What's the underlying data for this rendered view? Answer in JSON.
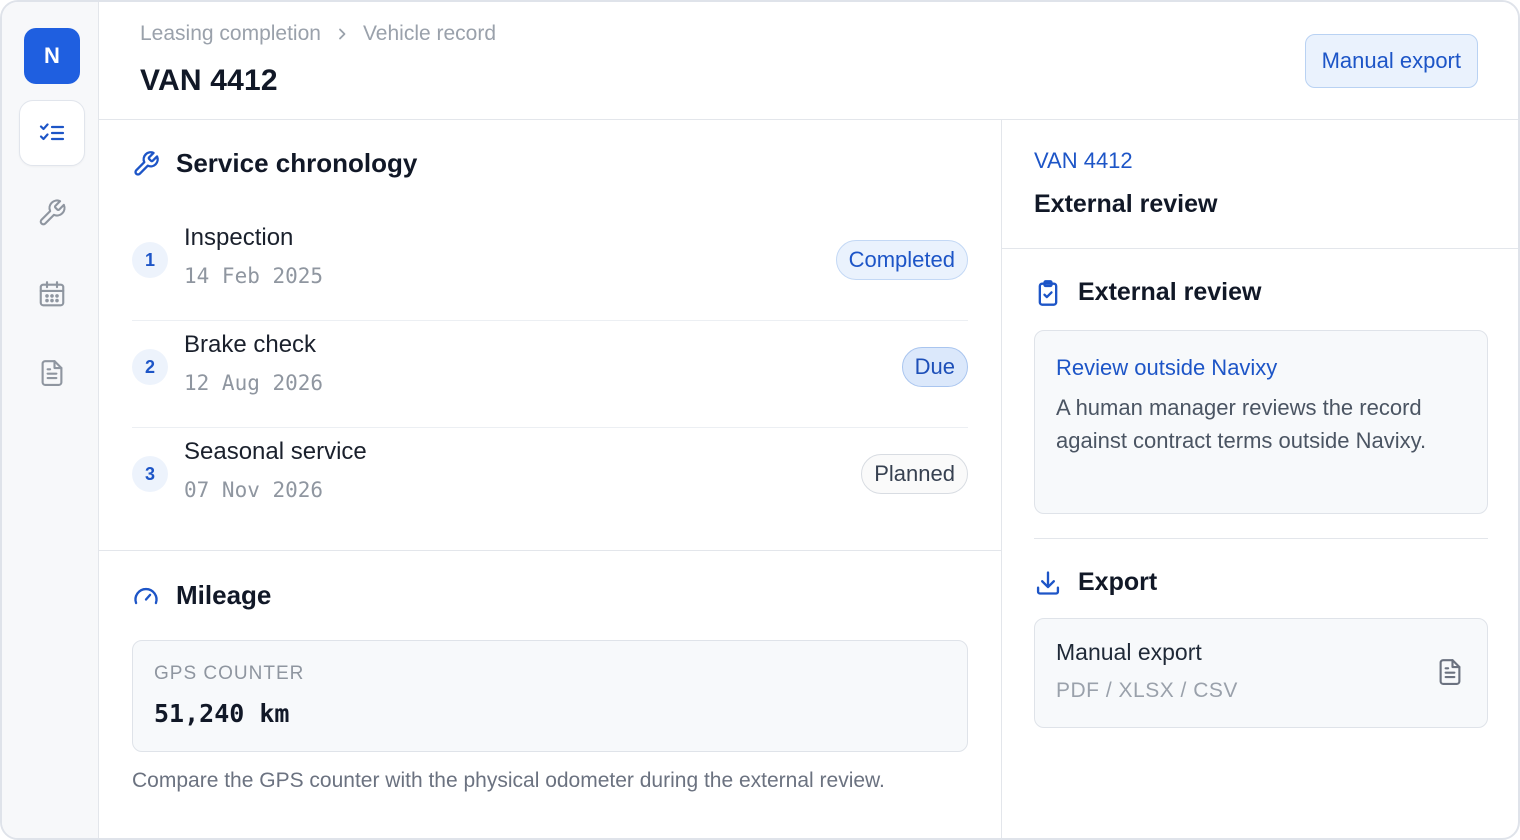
{
  "app": {
    "logo_letter": "N"
  },
  "sidebar": {
    "items": [
      {
        "icon": "checklist-icon",
        "active": true
      },
      {
        "icon": "wrench-icon",
        "active": false
      },
      {
        "icon": "calendar-icon",
        "active": false
      },
      {
        "icon": "document-icon",
        "active": false
      }
    ]
  },
  "breadcrumb": {
    "items": [
      "Leasing completion",
      "Vehicle record"
    ]
  },
  "header": {
    "title": "VAN 4412",
    "action_label": "Manual export"
  },
  "service": {
    "heading": "Service chronology",
    "items": [
      {
        "index": "1",
        "title": "Inspection",
        "date": "14 Feb 2025",
        "status": "Completed"
      },
      {
        "index": "2",
        "title": "Brake check",
        "date": "12 Aug 2026",
        "status": "Due"
      },
      {
        "index": "3",
        "title": "Seasonal service",
        "date": "07 Nov 2026",
        "status": "Planned"
      }
    ]
  },
  "mileage": {
    "heading": "Mileage",
    "counter_label": "GPS COUNTER",
    "counter_value": "51,240 km",
    "note": "Compare the GPS counter with the physical odometer during the external review."
  },
  "right_panel": {
    "vehicle": "VAN 4412",
    "title": "External review",
    "review": {
      "heading": "External review",
      "link": "Review outside Navixy",
      "body": "A human manager reviews the record against contract terms outside Navixy."
    },
    "export": {
      "heading": "Export",
      "title": "Manual export",
      "formats": "PDF / XLSX / CSV"
    }
  },
  "colors": {
    "accent": "#1f5fe0",
    "link": "#1d55c7"
  }
}
